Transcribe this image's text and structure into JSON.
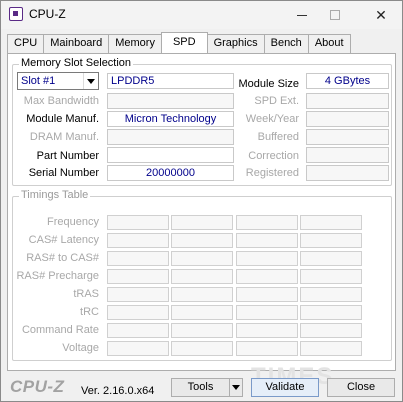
{
  "window": {
    "title": "CPU-Z",
    "min_glyph": "",
    "max_glyph": "",
    "close_glyph": "✕"
  },
  "tabs": [
    "CPU",
    "Mainboard",
    "Memory",
    "SPD",
    "Graphics",
    "Bench",
    "About"
  ],
  "active_tab": "SPD",
  "memory_slot": {
    "group_title": "Memory Slot Selection",
    "slot_value": "Slot #1",
    "memory_type": "LPDDR5",
    "left_fields": [
      {
        "label": "Max Bandwidth",
        "value": "",
        "enabled": false
      },
      {
        "label": "Module Manuf.",
        "value": "Micron Technology",
        "enabled": true
      },
      {
        "label": "DRAM Manuf.",
        "value": "",
        "enabled": false
      },
      {
        "label": "Part Number",
        "value": "",
        "enabled": true
      },
      {
        "label": "Serial Number",
        "value": "20000000",
        "enabled": true
      }
    ],
    "right_fields": [
      {
        "label": "Module Size",
        "value": "4 GBytes",
        "enabled": true
      },
      {
        "label": "SPD Ext.",
        "value": "",
        "enabled": false
      },
      {
        "label": "Week/Year",
        "value": "",
        "enabled": false
      },
      {
        "label": "Buffered",
        "value": "",
        "enabled": false
      },
      {
        "label": "Correction",
        "value": "",
        "enabled": false
      },
      {
        "label": "Registered",
        "value": "",
        "enabled": false
      }
    ]
  },
  "timings": {
    "group_title": "Timings Table",
    "rows": [
      "Frequency",
      "CAS# Latency",
      "RAS# to CAS#",
      "RAS# Precharge",
      "tRAS",
      "tRC",
      "Command Rate",
      "Voltage"
    ]
  },
  "footer": {
    "brand": "CPU-Z",
    "version": "Ver. 2.16.0.x64",
    "tools_label": "Tools",
    "validate_label": "Validate",
    "close_label": "Close",
    "watermark": "TIMES"
  }
}
